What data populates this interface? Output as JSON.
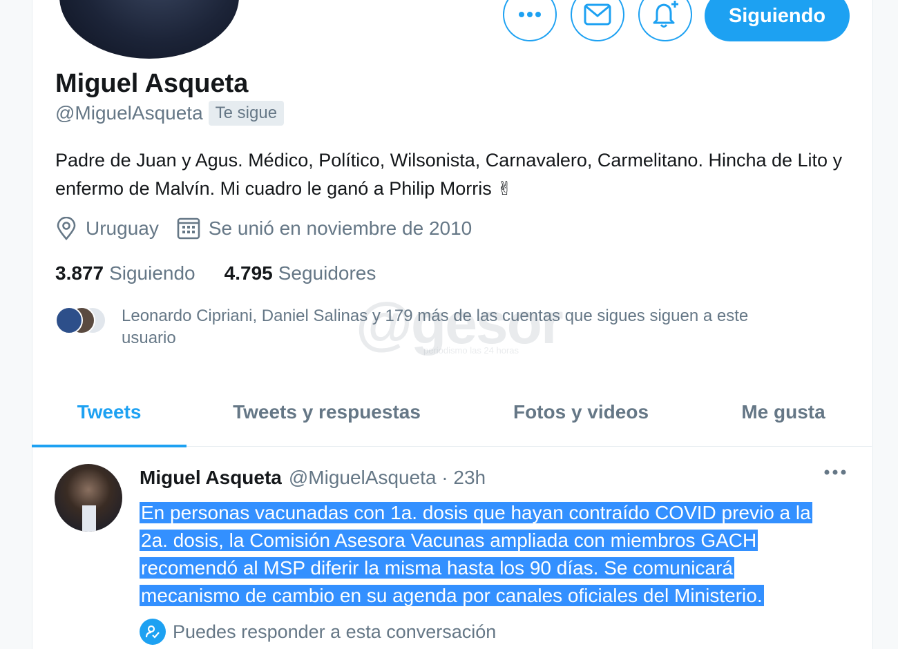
{
  "profile": {
    "follow_button": "Siguiendo",
    "name": "Miguel Asqueta",
    "handle": "@MiguelAsqueta",
    "follows_you": "Te sigue",
    "bio": "Padre de Juan y Agus. Médico, Político, Wilsonista, Carnavalero, Carmelitano. Hincha de Lito y enfermo de Malvín. Mi cuadro le ganó a Philip Morris ✌",
    "location": "Uruguay",
    "joined": "Se unió en noviembre de 2010",
    "following_count": "3.877",
    "following_label": "Siguiendo",
    "followers_count": "4.795",
    "followers_label": "Seguidores",
    "mutuals_text": "Leonardo Cipriani, Daniel Salinas y 179 más de las cuentas que sigues siguen a este usuario"
  },
  "watermark": {
    "main": "@gesor",
    "tagline": "periodismo las 24 horas"
  },
  "tabs": [
    {
      "label": "Tweets",
      "active": true
    },
    {
      "label": "Tweets y respuestas",
      "active": false
    },
    {
      "label": "Fotos y videos",
      "active": false
    },
    {
      "label": "Me gusta",
      "active": false
    }
  ],
  "tweet": {
    "author": "Miguel Asqueta",
    "handle_time": "@MiguelAsqueta · 23h",
    "lines": [
      "En personas vacunadas con 1a. dosis que hayan contraído COVID previo a la",
      "2a. dosis, la Comisión Asesora Vacunas ampliada con miembros GACH",
      "recomendó al MSP diferir la misma hasta los 90 días. Se comunicará",
      "mecanismo de cambio en su agenda por canales oficiales del Ministerio."
    ],
    "reply_note": "Puedes responder a esta conversación"
  },
  "icons": [
    "more-icon",
    "mail-icon",
    "bell-plus-icon",
    "location-pin-icon",
    "calendar-icon",
    "more-horizontal-icon",
    "reply-permission-icon"
  ],
  "colors": {
    "accent": "#1da1f2",
    "selection": "#3390ff",
    "muted": "#657786"
  }
}
